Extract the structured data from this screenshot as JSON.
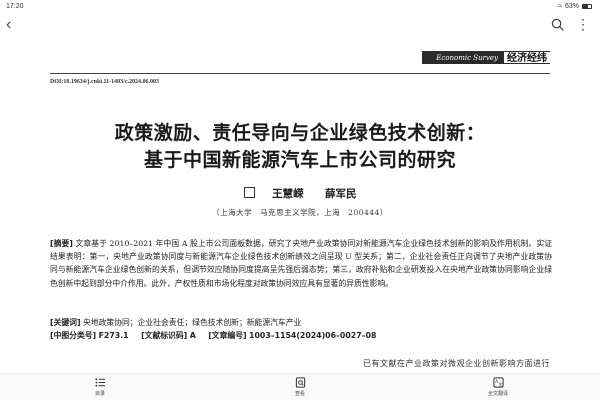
{
  "status": {
    "time": "17:20",
    "battery": "63%",
    "wifi": "≈"
  },
  "nav": {
    "back_glyph": "‹",
    "more_glyph": "⋮"
  },
  "journal": {
    "en": "Economic Survey",
    "cn": "经济经纬"
  },
  "doi": "DOI:10.19634/j.cnki.11-1403/c.2024.06.003",
  "title": {
    "line1": "政策激励、责任导向与企业绿色技术创新：",
    "line2": "基于中国新能源汽车上市公司的研究"
  },
  "authors": [
    "王慧嵘",
    "薛军民"
  ],
  "affiliation": "（上海大学　马克思主义学院，上海　200444）",
  "abstract": {
    "label": "[摘要]",
    "text": "文章基于 2010–2021 年中国 A 股上市公司面板数据，研究了央地产业政策协同对新能源汽车企业绿色技术创新的影响及作用机制。实证结果表明：第一，央地产业政策协同度与新能源汽车企业绿色技术创新绩效之间呈现 U 型关系；第二，企业社会责任正向调节了央地产业政策协同与新能源汽车企业绿色创新的关系，但调节效应随协同度提高呈先强后弱态势；第三，政府补贴和企业研发投入在央地产业政策协同影响企业绿色创新中起到部分中介作用。此外，产权性质和市场化程度对政策协同效应具有显著的异质性影响。"
  },
  "keywords": {
    "label": "[关键词]",
    "text": "央地政策协同；企业社会责任；绿色技术创新；新能源汽车产业"
  },
  "classification": {
    "clc_label": "[中图分类号]",
    "clc_value": "F273.1",
    "doc_label": "[文献标识码]",
    "doc_value": "A",
    "art_label": "[文章编号]",
    "art_value": "1003–1154(2024)06–0027–08"
  },
  "body_start": "已有文献在产业政策对微观企业创新影响方面进行",
  "bottom_bar": {
    "toc": "目录",
    "view": "查看",
    "translate": "全文翻译"
  }
}
